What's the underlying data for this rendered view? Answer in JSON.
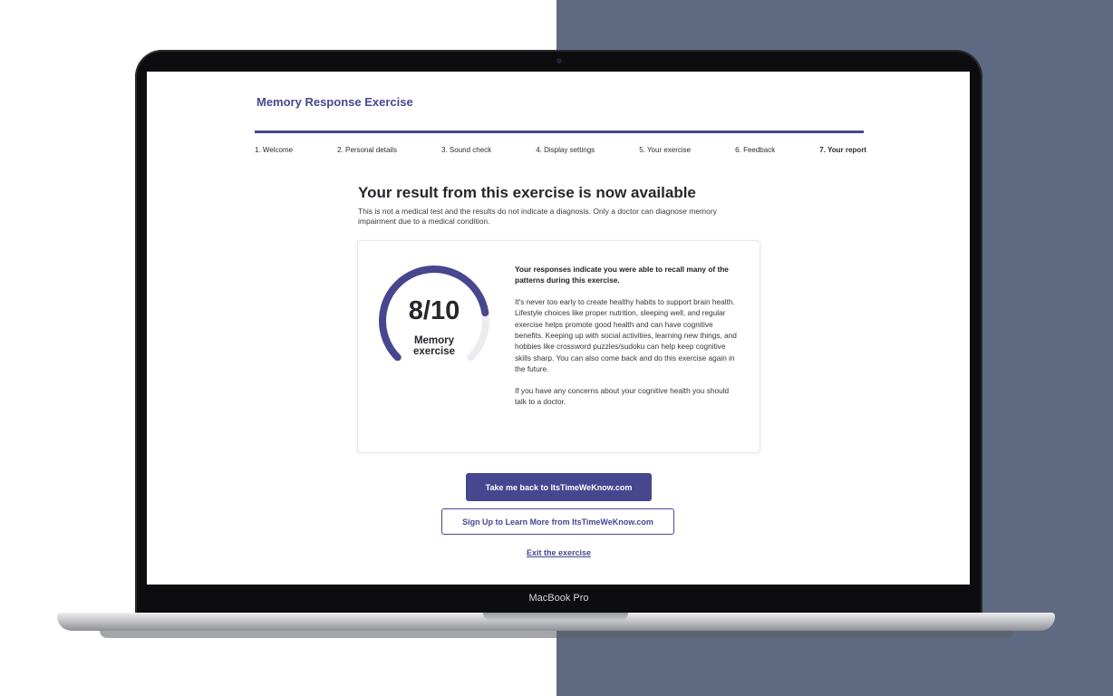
{
  "device": {
    "label": "MacBook Pro"
  },
  "app": {
    "title": "Memory Response Exercise"
  },
  "colors": {
    "brand": "#46478f",
    "gauge_track": "#ebebf0",
    "right_background": "#5f6a83"
  },
  "progress": {
    "fraction": 1.0
  },
  "steps": [
    {
      "label": "1. Welcome",
      "active": false
    },
    {
      "label": "2. Personal details",
      "active": false
    },
    {
      "label": "3. Sound check",
      "active": false
    },
    {
      "label": "4. Display settings",
      "active": false
    },
    {
      "label": "5. Your exercise",
      "active": false
    },
    {
      "label": "6. Feedback",
      "active": false
    },
    {
      "label": "7. Your report",
      "active": true
    }
  ],
  "result": {
    "heading": "Your result from this exercise is now available",
    "disclaimer": "This is not a medical test and the results do not indicate a diagnosis. Only a doctor can diagnose memory impairment due to a medical condition.",
    "score_text": "8/10",
    "score_value": 8,
    "score_max": 10,
    "score_label": "Memory exercise",
    "lead": "Your responses indicate you were able to recall many of the patterns during this exercise.",
    "paragraph_1": "It's never too early to create healthy habits to support brain health. Lifestyle choices like proper nutrition, sleeping well, and regular exercise helps promote good health and can have cognitive benefits. Keeping up with social activities, learning new things, and hobbies like crossword puzzles/sudoku can help keep cognitive skills sharp. You can also come back and do this exercise again in the future.",
    "paragraph_2": "If you have any concerns about your cognitive health you should talk to a doctor."
  },
  "actions": {
    "primary_label": "Take me back to ItsTimeWeKnow.com",
    "secondary_label": "Sign Up to Learn More from ItsTimeWeKnow.com",
    "exit_label": "Exit the exercise"
  }
}
